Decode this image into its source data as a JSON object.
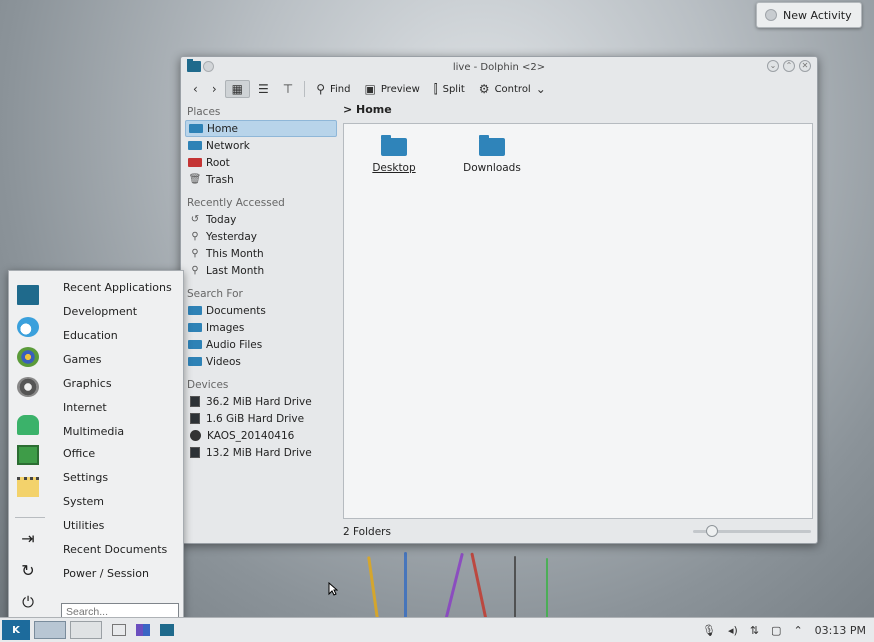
{
  "new_activity": {
    "label": "New Activity"
  },
  "window": {
    "title": "live - Dolphin <2>",
    "toolbar": {
      "find": "Find",
      "preview": "Preview",
      "split": "Split",
      "control": "Control"
    },
    "places": {
      "header": "Places",
      "items": [
        {
          "label": "Home",
          "selected": true
        },
        {
          "label": "Network"
        },
        {
          "label": "Root"
        },
        {
          "label": "Trash"
        }
      ]
    },
    "recent": {
      "header": "Recently Accessed",
      "items": [
        {
          "label": "Today"
        },
        {
          "label": "Yesterday"
        },
        {
          "label": "This Month"
        },
        {
          "label": "Last Month"
        }
      ]
    },
    "search_for": {
      "header": "Search For",
      "items": [
        {
          "label": "Documents"
        },
        {
          "label": "Images"
        },
        {
          "label": "Audio Files"
        },
        {
          "label": "Videos"
        }
      ]
    },
    "devices": {
      "header": "Devices",
      "items": [
        {
          "label": "36.2 MiB Hard Drive"
        },
        {
          "label": "1.6 GiB Hard Drive"
        },
        {
          "label": "KAOS_20140416"
        },
        {
          "label": "13.2 MiB Hard Drive"
        }
      ]
    },
    "breadcrumb": "> Home",
    "files": [
      {
        "label": "Desktop"
      },
      {
        "label": "Downloads"
      }
    ],
    "status": "2 Folders",
    "zoom_fraction": 0.12
  },
  "launcher": {
    "categories": [
      "Recent Applications",
      "Development",
      "Education",
      "Games",
      "Graphics",
      "Internet",
      "Multimedia",
      "Office",
      "Settings",
      "System",
      "Utilities",
      "Recent Documents",
      "Power / Session"
    ],
    "search_placeholder": "Search..."
  },
  "taskbar": {
    "clock": "03:13 PM"
  },
  "colors": {
    "accent": "#2f84ba",
    "selection": "#b8d4ea"
  }
}
